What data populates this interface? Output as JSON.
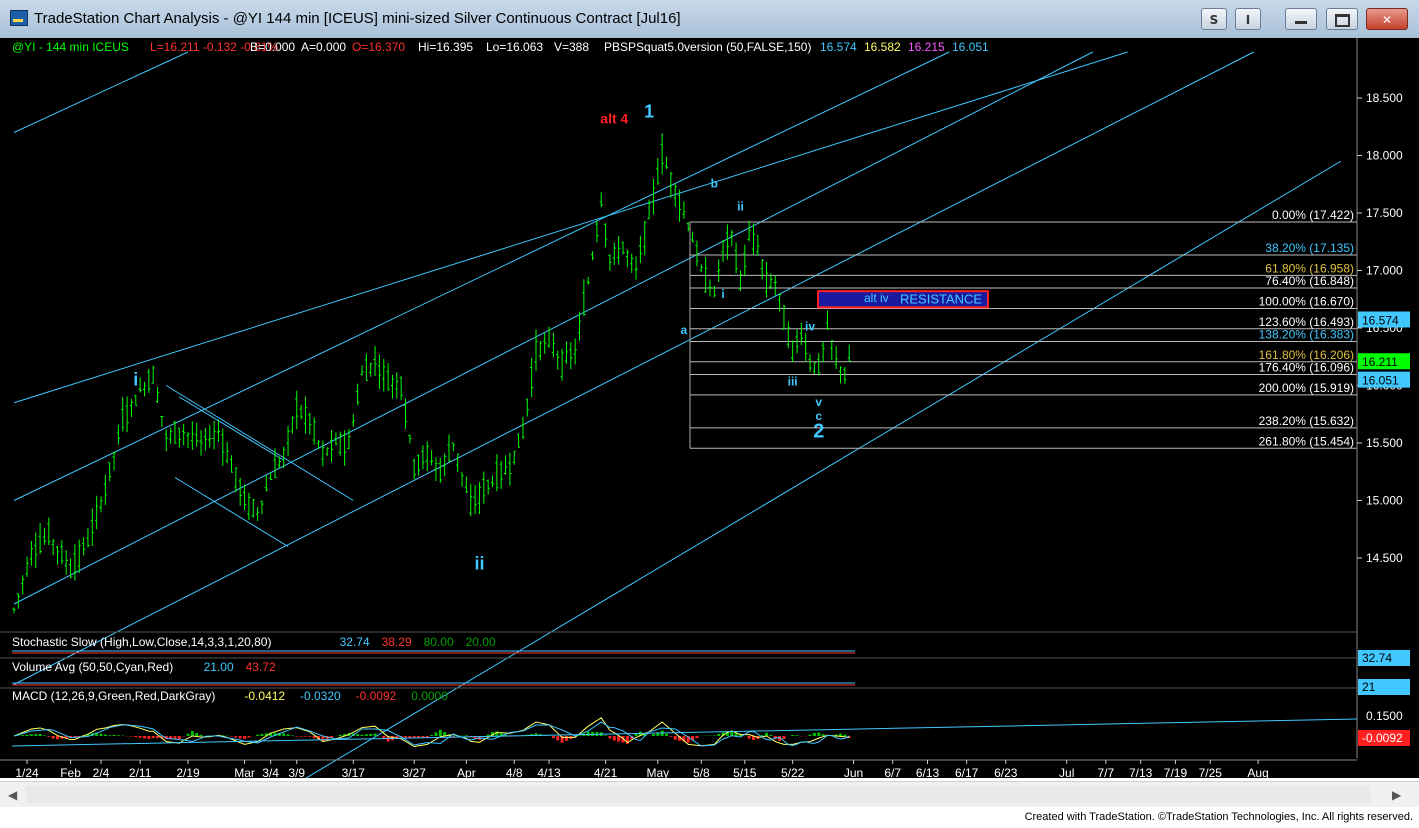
{
  "window": {
    "title": "TradeStation Chart Analysis - @YI 144 min [ICEUS] mini-sized Silver Continuous Contract [Jul16]",
    "btn_s": "S",
    "btn_i": "I"
  },
  "header": [
    {
      "text": "@YI - 144 min  ICEUS",
      "color": "#00ff00"
    },
    {
      "text": "L=16.211  -0.132  -0.81%",
      "color": "#ff3030"
    },
    {
      "text": "B=0.000",
      "color": "#ffffff"
    },
    {
      "text": "A=0.000",
      "color": "#ffffff"
    },
    {
      "text": "O=16.370",
      "color": "#ff3030"
    },
    {
      "text": "Hi=16.395",
      "color": "#ffffff"
    },
    {
      "text": "Lo=16.063",
      "color": "#ffffff"
    },
    {
      "text": "V=388",
      "color": "#ffffff"
    },
    {
      "text": "PBSPSquat5.0version (50,FALSE,150)",
      "color": "#ffffff"
    },
    {
      "text": "16.574",
      "color": "#40c8ff"
    },
    {
      "text": "16.582",
      "color": "#ffff66"
    },
    {
      "text": "16.215",
      "color": "#ff55ff"
    },
    {
      "text": "16.051",
      "color": "#40c8ff"
    }
  ],
  "price_axis": [
    "18.500",
    "18.000",
    "17.500",
    "17.000",
    "16.500",
    "16.000",
    "15.500",
    "15.000",
    "14.500"
  ],
  "price_tags": [
    {
      "text": "16.574",
      "value": 16.574,
      "bg": "#40c8ff",
      "fg": "#000000"
    },
    {
      "text": "16.211",
      "value": 16.211,
      "bg": "#00ff00",
      "fg": "#000000"
    },
    {
      "text": "16.051",
      "value": 16.051,
      "bg": "#40c8ff",
      "fg": "#000000"
    }
  ],
  "fib_levels": [
    {
      "label": "0.00% (17.422)",
      "value": 17.422,
      "color": "#ffffff"
    },
    {
      "label": "38.20% (17.135)",
      "value": 17.135,
      "color": "#40c8ff"
    },
    {
      "label": "61.80% (16.958)",
      "value": 16.958,
      "color": "#e0c040"
    },
    {
      "label": "76.40% (16.848)",
      "value": 16.848,
      "color": "#ffffff"
    },
    {
      "label": "100.00% (16.670)",
      "value": 16.67,
      "color": "#ffffff"
    },
    {
      "label": "123.60% (16.493)",
      "value": 16.493,
      "color": "#ffffff"
    },
    {
      "label": "138.20% (16.383)",
      "value": 16.383,
      "color": "#40c8ff"
    },
    {
      "label": "161.80% (16.206)",
      "value": 16.206,
      "color": "#e0c040"
    },
    {
      "label": "176.40% (16.096)",
      "value": 16.096,
      "color": "#ffffff"
    },
    {
      "label": "200.00% (15.919)",
      "value": 15.919,
      "color": "#ffffff"
    },
    {
      "label": "238.20% (15.632)",
      "value": 15.632,
      "color": "#ffffff"
    },
    {
      "label": "261.80% (15.454)",
      "value": 15.454,
      "color": "#ffffff"
    }
  ],
  "resistance_box": {
    "label_alt": "alt iv",
    "label": "RESISTANCE",
    "top": 16.82,
    "bottom": 16.68
  },
  "wave_labels": [
    {
      "text": "alt 4",
      "color": "#ff2020",
      "bar": 138,
      "value": 18.28,
      "size": 14
    },
    {
      "text": "1",
      "color": "#40c8ff",
      "bar": 146,
      "value": 18.33,
      "size": 18
    },
    {
      "text": "i",
      "color": "#40c8ff",
      "bar": 28,
      "value": 16.0,
      "size": 18
    },
    {
      "text": "ii",
      "color": "#40c8ff",
      "bar": 107,
      "value": 14.4,
      "size": 18
    },
    {
      "text": "a",
      "color": "#40c8ff",
      "bar": 154,
      "value": 16.45,
      "size": 12
    },
    {
      "text": "b",
      "color": "#40c8ff",
      "bar": 161,
      "value": 17.72,
      "size": 12
    },
    {
      "text": "i",
      "color": "#40c8ff",
      "bar": 163,
      "value": 16.76,
      "size": 12
    },
    {
      "text": "ii",
      "color": "#40c8ff",
      "bar": 167,
      "value": 17.52,
      "size": 12
    },
    {
      "text": "iv",
      "color": "#40c8ff",
      "bar": 183,
      "value": 16.48,
      "size": 12
    },
    {
      "text": "iii",
      "color": "#40c8ff",
      "bar": 179,
      "value": 16.0,
      "size": 12
    },
    {
      "text": "v",
      "color": "#40c8ff",
      "bar": 185,
      "value": 15.82,
      "size": 12
    },
    {
      "text": "c",
      "color": "#40c8ff",
      "bar": 185,
      "value": 15.7,
      "size": 12
    },
    {
      "text": "2",
      "color": "#40c8ff",
      "bar": 185,
      "value": 15.55,
      "size": 20
    }
  ],
  "indicators": {
    "stochastic": [
      {
        "text": "Stochastic Slow (High,Low,Close,14,3,3,1,20,80)",
        "color": "#ffffff"
      },
      {
        "text": "32.74",
        "color": "#40c8ff"
      },
      {
        "text": "38.29",
        "color": "#ff3030"
      },
      {
        "text": "80.00",
        "color": "#00a000"
      },
      {
        "text": "20.00",
        "color": "#00a000"
      }
    ],
    "volume": [
      {
        "text": "Volume Avg (50,50,Cyan,Red)",
        "color": "#ffffff"
      },
      {
        "text": "21.00",
        "color": "#40c8ff"
      },
      {
        "text": "43.72",
        "color": "#ff3030"
      }
    ],
    "macd": [
      {
        "text": "MACD (12,26,9,Green,Red,DarkGray)",
        "color": "#ffffff"
      },
      {
        "text": "-0.0412",
        "color": "#ffff66"
      },
      {
        "text": "-0.0320",
        "color": "#40c8ff"
      },
      {
        "text": "-0.0092",
        "color": "#ff3030"
      },
      {
        "text": "0.0000",
        "color": "#00a000"
      }
    ],
    "stoch_tag": "32.74",
    "volume_tag": "21",
    "macd_axis": "0.1500",
    "macd_tag": "-0.0092"
  },
  "date_axis": [
    {
      "label": "1/24",
      "bar": 3
    },
    {
      "label": "Feb",
      "bar": 13
    },
    {
      "label": "2/4",
      "bar": 20
    },
    {
      "label": "2/11",
      "bar": 29
    },
    {
      "label": "2/19",
      "bar": 40
    },
    {
      "label": "Mar",
      "bar": 53
    },
    {
      "label": "3/4",
      "bar": 59
    },
    {
      "label": "3/9",
      "bar": 65
    },
    {
      "label": "3/17",
      "bar": 78
    },
    {
      "label": "3/27",
      "bar": 92
    },
    {
      "label": "Apr",
      "bar": 104
    },
    {
      "label": "4/8",
      "bar": 115
    },
    {
      "label": "4/13",
      "bar": 123
    },
    {
      "label": "4/21",
      "bar": 136
    },
    {
      "label": "May",
      "bar": 148
    },
    {
      "label": "5/8",
      "bar": 158
    },
    {
      "label": "5/15",
      "bar": 168
    },
    {
      "label": "5/22",
      "bar": 179
    },
    {
      "label": "Jun",
      "bar": 193
    },
    {
      "label": "6/7",
      "bar": 202
    },
    {
      "label": "6/13",
      "bar": 210
    },
    {
      "label": "6/17",
      "bar": 219
    },
    {
      "label": "6/23",
      "bar": 228
    },
    {
      "label": "Jul",
      "bar": 242
    },
    {
      "label": "7/7",
      "bar": 251
    },
    {
      "label": "7/13",
      "bar": 259
    },
    {
      "label": "7/19",
      "bar": 267
    },
    {
      "label": "7/25",
      "bar": 275
    },
    {
      "label": "Aug",
      "bar": 286
    }
  ],
  "chart_data": {
    "type": "line",
    "title": "@YI 144 min [ICEUS] mini-sized Silver Continuous Contract [Jul16]",
    "xlabel": "",
    "ylabel": "",
    "ylim": [
      14.1,
      18.9
    ],
    "grid": false,
    "series": [
      {
        "name": "@YI",
        "anchors": [
          [
            0,
            14.05
          ],
          [
            4,
            14.55
          ],
          [
            8,
            14.7
          ],
          [
            13,
            14.4
          ],
          [
            17,
            14.65
          ],
          [
            21,
            15.1
          ],
          [
            25,
            15.7
          ],
          [
            29,
            15.95
          ],
          [
            32,
            16.1
          ],
          [
            35,
            15.55
          ],
          [
            39,
            15.6
          ],
          [
            43,
            15.5
          ],
          [
            47,
            15.6
          ],
          [
            50,
            15.3
          ],
          [
            53,
            15.0
          ],
          [
            56,
            14.9
          ],
          [
            59,
            15.2
          ],
          [
            62,
            15.4
          ],
          [
            65,
            15.8
          ],
          [
            68,
            15.7
          ],
          [
            71,
            15.4
          ],
          [
            74,
            15.5
          ],
          [
            77,
            15.5
          ],
          [
            80,
            16.1
          ],
          [
            83,
            16.2
          ],
          [
            86,
            16.05
          ],
          [
            89,
            16.0
          ],
          [
            92,
            15.3
          ],
          [
            95,
            15.4
          ],
          [
            98,
            15.25
          ],
          [
            101,
            15.5
          ],
          [
            105,
            14.95
          ],
          [
            108,
            15.1
          ],
          [
            111,
            15.2
          ],
          [
            114,
            15.3
          ],
          [
            117,
            15.6
          ],
          [
            120,
            16.3
          ],
          [
            123,
            16.4
          ],
          [
            126,
            16.2
          ],
          [
            129,
            16.3
          ],
          [
            132,
            16.9
          ],
          [
            135,
            17.6
          ],
          [
            137,
            17.1
          ],
          [
            140,
            17.2
          ],
          [
            143,
            17.0
          ],
          [
            146,
            17.5
          ],
          [
            149,
            18.0
          ],
          [
            152,
            17.7
          ],
          [
            155,
            17.4
          ],
          [
            158,
            17.0
          ],
          [
            161,
            16.8
          ],
          [
            163,
            17.2
          ],
          [
            165,
            17.3
          ],
          [
            167,
            16.9
          ],
          [
            169,
            17.3
          ],
          [
            171,
            17.2
          ],
          [
            173,
            16.9
          ],
          [
            175,
            16.9
          ],
          [
            177,
            16.6
          ],
          [
            179,
            16.3
          ],
          [
            181,
            16.45
          ],
          [
            183,
            16.2
          ],
          [
            185,
            16.15
          ],
          [
            187,
            16.5
          ],
          [
            189,
            16.2
          ],
          [
            191,
            16.1
          ],
          [
            192,
            16.21
          ]
        ]
      }
    ],
    "price_axis_ticks": [
      14.5,
      15.0,
      15.5,
      16.0,
      16.5,
      17.0,
      17.5,
      18.0,
      18.5
    ]
  },
  "footer": "Created with TradeStation. ©TradeStation Technologies, Inc. All rights reserved."
}
